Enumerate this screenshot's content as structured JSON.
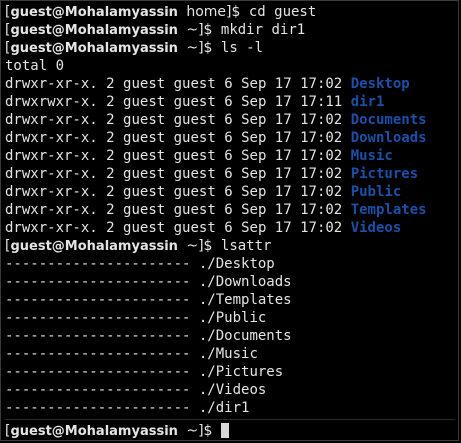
{
  "prompts": [
    {
      "user": "guest@Mohalamyassin",
      "dir": "home",
      "command": "cd guest"
    },
    {
      "user": "guest@Mohalamyassin",
      "dir": "~",
      "command": "mkdir dir1"
    },
    {
      "user": "guest@Mohalamyassin",
      "dir": "~",
      "command": "ls -l"
    },
    {
      "user": "guest@Mohalamyassin",
      "dir": "~",
      "command": "lsattr"
    },
    {
      "user": "guest@Mohalamyassin",
      "dir": "~",
      "command": ""
    }
  ],
  "ls_total": "total 0",
  "ls_entries": [
    {
      "perms": "drwxr-xr-x.",
      "links": "2",
      "owner": "guest",
      "group": "guest",
      "size": "6",
      "date": "Sep 17 17:02",
      "name": "Desktop"
    },
    {
      "perms": "drwxrwxr-x.",
      "links": "2",
      "owner": "guest",
      "group": "guest",
      "size": "6",
      "date": "Sep 17 17:11",
      "name": "dir1"
    },
    {
      "perms": "drwxr-xr-x.",
      "links": "2",
      "owner": "guest",
      "group": "guest",
      "size": "6",
      "date": "Sep 17 17:02",
      "name": "Documents"
    },
    {
      "perms": "drwxr-xr-x.",
      "links": "2",
      "owner": "guest",
      "group": "guest",
      "size": "6",
      "date": "Sep 17 17:02",
      "name": "Downloads"
    },
    {
      "perms": "drwxr-xr-x.",
      "links": "2",
      "owner": "guest",
      "group": "guest",
      "size": "6",
      "date": "Sep 17 17:02",
      "name": "Music"
    },
    {
      "perms": "drwxr-xr-x.",
      "links": "2",
      "owner": "guest",
      "group": "guest",
      "size": "6",
      "date": "Sep 17 17:02",
      "name": "Pictures"
    },
    {
      "perms": "drwxr-xr-x.",
      "links": "2",
      "owner": "guest",
      "group": "guest",
      "size": "6",
      "date": "Sep 17 17:02",
      "name": "Public"
    },
    {
      "perms": "drwxr-xr-x.",
      "links": "2",
      "owner": "guest",
      "group": "guest",
      "size": "6",
      "date": "Sep 17 17:02",
      "name": "Templates"
    },
    {
      "perms": "drwxr-xr-x.",
      "links": "2",
      "owner": "guest",
      "group": "guest",
      "size": "6",
      "date": "Sep 17 17:02",
      "name": "Videos"
    }
  ],
  "lsattr_entries": [
    {
      "attrs": "----------------------",
      "path": "./Desktop"
    },
    {
      "attrs": "----------------------",
      "path": "./Downloads"
    },
    {
      "attrs": "----------------------",
      "path": "./Templates"
    },
    {
      "attrs": "----------------------",
      "path": "./Public"
    },
    {
      "attrs": "----------------------",
      "path": "./Documents"
    },
    {
      "attrs": "----------------------",
      "path": "./Music"
    },
    {
      "attrs": "----------------------",
      "path": "./Pictures"
    },
    {
      "attrs": "----------------------",
      "path": "./Videos"
    },
    {
      "attrs": "----------------------",
      "path": "./dir1"
    }
  ],
  "colors": {
    "background": "#000000",
    "text": "#e4e4e4",
    "directory": "#1c4fa8",
    "cursor": "#d8d8d8"
  }
}
